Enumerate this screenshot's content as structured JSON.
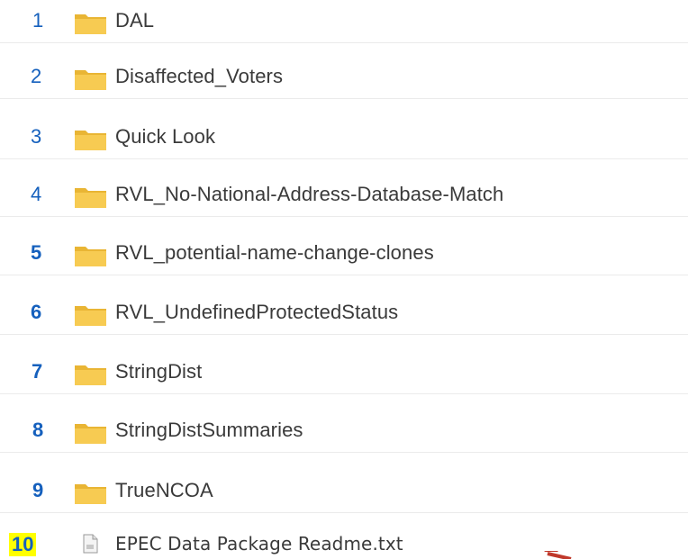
{
  "items": [
    {
      "number": "1",
      "name": "DAL",
      "type": "folder"
    },
    {
      "number": "2",
      "name": "Disaffected_Voters",
      "type": "folder"
    },
    {
      "number": "3",
      "name": "Quick Look",
      "type": "folder"
    },
    {
      "number": "4",
      "name": "RVL_No-National-Address-Database-Match",
      "type": "folder"
    },
    {
      "number": "5",
      "name": "RVL_potential-name-change-clones",
      "type": "folder"
    },
    {
      "number": "6",
      "name": "RVL_UndefinedProtectedStatus",
      "type": "folder"
    },
    {
      "number": "7",
      "name": "StringDist",
      "type": "folder"
    },
    {
      "number": "8",
      "name": "StringDistSummaries",
      "type": "folder"
    },
    {
      "number": "9",
      "name": "TrueNCOA",
      "type": "folder"
    },
    {
      "number": "10",
      "name": "EPEC Data Package Readme.txt",
      "type": "text-file"
    }
  ],
  "icons": {
    "folder": "folder-icon",
    "text_file": "text-file-icon",
    "annotation": "red-arrow-icon"
  },
  "colors": {
    "number": "#1560bd",
    "highlight": "#ffff00",
    "folder": "#f5c542",
    "text": "#3a3a3a",
    "arrow": "#c0392b"
  }
}
